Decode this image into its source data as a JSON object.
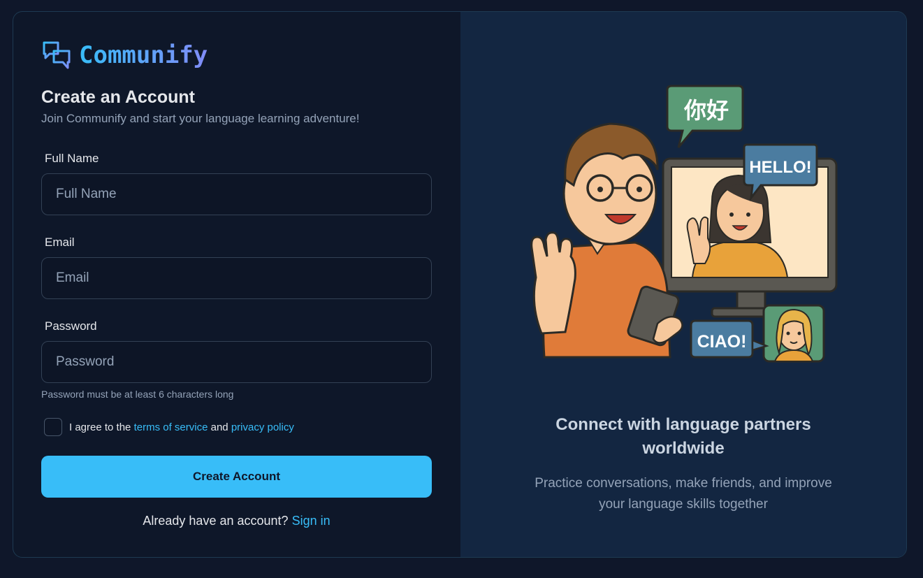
{
  "brand": {
    "name": "Communify"
  },
  "form": {
    "title": "Create an Account",
    "subtitle": "Join Communify and start your language learning adventure!",
    "full_name": {
      "label": "Full Name",
      "placeholder": "Full Name",
      "value": ""
    },
    "email": {
      "label": "Email",
      "placeholder": "Email",
      "value": ""
    },
    "password": {
      "label": "Password",
      "placeholder": "Password",
      "value": "",
      "hint": "Password must be at least 6 characters long"
    },
    "agree": {
      "prefix": "I agree to the",
      "terms_link": "terms of service",
      "conjunction": "and",
      "privacy_link": "privacy policy",
      "checked": false
    },
    "submit_label": "Create Account",
    "signin_prompt": "Already have an account?",
    "signin_link": "Sign in"
  },
  "illustration": {
    "bubble_chinese": "你好",
    "bubble_hello": "HELLO!",
    "bubble_ciao": "CIAO!"
  },
  "promo": {
    "tagline_line1": "Connect with language partners",
    "tagline_line2": "worldwide",
    "desc_line1": "Practice conversations, make friends, and improve",
    "desc_line2": "your language skills together"
  },
  "colors": {
    "accent": "#38bdf8",
    "accent_secondary": "#818cf8",
    "background": "#0f172a",
    "panel_right": "#132641"
  }
}
